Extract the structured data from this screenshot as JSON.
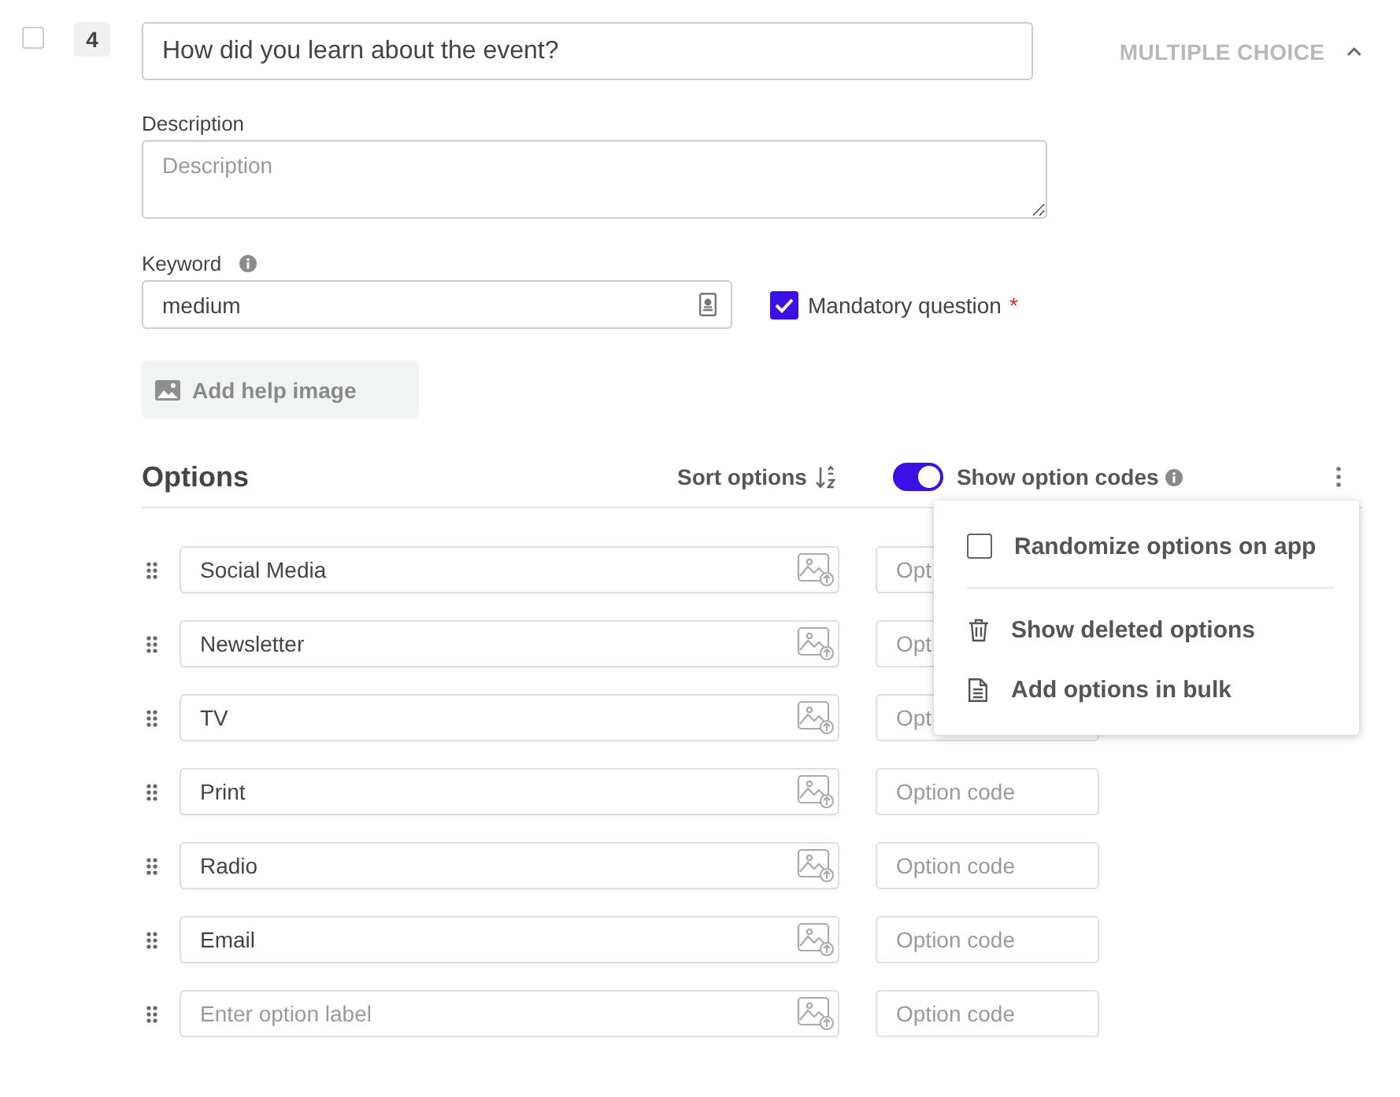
{
  "question": {
    "number": "4",
    "selected": false,
    "title": "How did you learn about the event?",
    "type": "MULTIPLE CHOICE",
    "expanded": true
  },
  "description": {
    "label": "Description",
    "placeholder": "Description"
  },
  "keyword": {
    "label": "Keyword",
    "value": "medium"
  },
  "mandatory": {
    "label": "Mandatory question",
    "checked": true,
    "marker": "*"
  },
  "help_image_button": "Add help image",
  "options_section": {
    "title": "Options",
    "sort_label": "Sort options",
    "show_codes": {
      "label": "Show option codes",
      "on": true
    }
  },
  "options": [
    {
      "label": "Social Media",
      "code_placeholder": "Opt"
    },
    {
      "label": "Newsletter",
      "code_placeholder": "Opt"
    },
    {
      "label": "TV",
      "code_placeholder": "Opt"
    },
    {
      "label": "Print",
      "code_placeholder": "Option code"
    },
    {
      "label": "Radio",
      "code_placeholder": "Option code"
    },
    {
      "label": "Email",
      "code_placeholder": "Option code"
    },
    {
      "placeholder": "Enter option label",
      "code_placeholder": "Option code"
    }
  ],
  "menu": {
    "items": [
      {
        "kind": "checkbox",
        "label": "Randomize options on app",
        "checked": false
      },
      {
        "kind": "action",
        "label": "Show deleted options"
      },
      {
        "kind": "action",
        "label": "Add options in bulk"
      }
    ]
  }
}
